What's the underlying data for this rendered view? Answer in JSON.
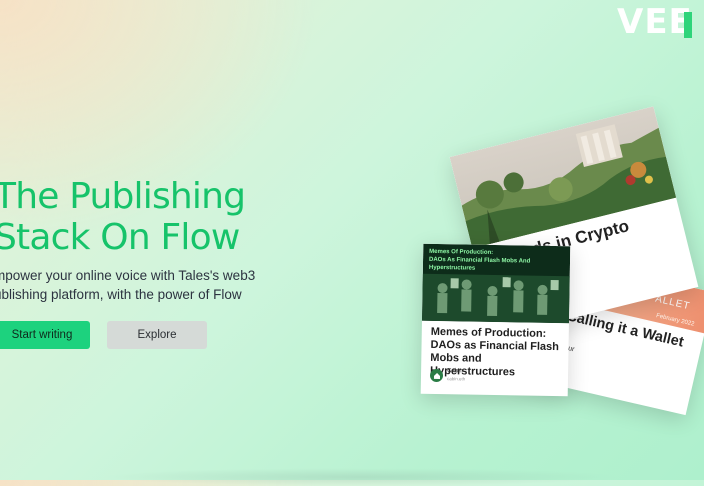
{
  "brand": {
    "logo_text": "VEE"
  },
  "hero": {
    "title_line1": "The Publishing",
    "title_line2": "Stack On Flow",
    "subtitle_line1": "mpower your online voice with Tales's web3",
    "subtitle_line2": "ublishing platform, with the power of Flow"
  },
  "buttons": {
    "start_writing": "Start writing",
    "explore": "Explore"
  },
  "cards": {
    "back": {
      "banner_tag": "ALLET",
      "banner_date": "February 2022",
      "title": "Calling it a Wallet",
      "author": "an Hour",
      "author_sub": "2022"
    },
    "middle": {
      "title": "Goods in Crypto"
    },
    "front": {
      "image_caption_line1": "Memes Of Production:",
      "image_caption_line2": "DAOs As Financial Flash Mobs And Hyperstructures",
      "title": "Memes of Production: DAOs as Financial Flash Mobs and Hyperstructures",
      "author": "Cabin",
      "author_sub": "cabin.eth"
    }
  },
  "colors": {
    "accent_green": "#16c36a",
    "button_green": "#1dd27e",
    "button_gray": "#d5dad7"
  }
}
